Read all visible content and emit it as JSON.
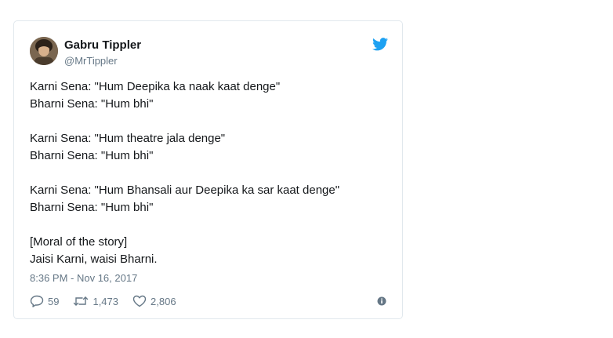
{
  "tweet": {
    "author_name": "Gabru Tippler",
    "author_handle": "@MrTippler",
    "lines": [
      "Karni Sena: \"Hum Deepika ka naak kaat denge\"",
      "Bharni Sena: \"Hum bhi\"",
      "",
      "Karni Sena: \"Hum theatre jala denge\"",
      "Bharni Sena: \"Hum bhi\"",
      "",
      "Karni Sena: \"Hum Bhansali aur Deepika ka sar kaat denge\"",
      "Bharni Sena: \"Hum bhi\"",
      "",
      "[Moral of the story]",
      "Jaisi Karni, waisi Bharni."
    ],
    "timestamp": "8:36 PM - Nov 16, 2017",
    "replies": "59",
    "retweets": "1,473",
    "likes": "2,806"
  },
  "icons": {
    "brand": "twitter-bird-icon",
    "reply": "reply-icon",
    "retweet": "retweet-icon",
    "like": "heart-icon",
    "info": "info-icon"
  },
  "colors": {
    "brand": "#1da1f2",
    "text": "#14171a",
    "muted": "#657786",
    "border": "#e1e8ed"
  }
}
